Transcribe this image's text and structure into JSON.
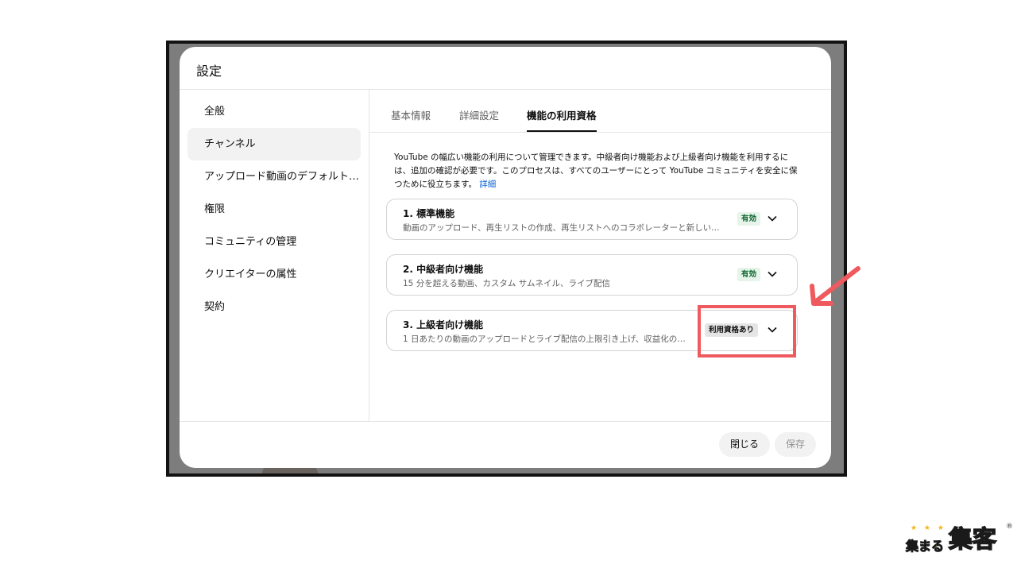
{
  "dialog": {
    "title": "設定"
  },
  "sidebar": {
    "items": [
      {
        "label": "全般"
      },
      {
        "label": "チャンネル"
      },
      {
        "label": "アップロード動画のデフォルト設定"
      },
      {
        "label": "権限"
      },
      {
        "label": "コミュニティの管理"
      },
      {
        "label": "クリエイターの属性"
      },
      {
        "label": "契約"
      }
    ]
  },
  "tabs": [
    {
      "label": "基本情報"
    },
    {
      "label": "詳細設定"
    },
    {
      "label": "機能の利用資格"
    }
  ],
  "description": {
    "text": "YouTube の幅広い機能の利用について管理できます。中級者向け機能および上級者向け機能を利用するには、追加の確認が必要です。このプロセスは、すべてのユーザーにとって YouTube コミュニティを安全に保つために役立ちます。",
    "link": "詳細"
  },
  "features": [
    {
      "title": "1. 標準機能",
      "subtitle": "動画のアップロード、再生リストの作成、再生リストへのコラボレーターと新しい…",
      "status": "有効"
    },
    {
      "title": "2. 中級者向け機能",
      "subtitle": "15 分を超える動画、カスタム サムネイル、ライブ配信",
      "status": "有効"
    },
    {
      "title": "3. 上級者向け機能",
      "subtitle": "1 日あたりの動画のアップロードとライブ配信の上限引き上げ、収益化の…",
      "status": "利用資格あり"
    }
  ],
  "footer": {
    "close_label": "閉じる",
    "save_label": "保存"
  },
  "colors": {
    "highlight": "#ef5a5f",
    "link": "#065fd4",
    "enabled_badge": "#e6f4ea",
    "logo_pink": "#ee4f9a",
    "logo_yellow": "#f3b51c"
  },
  "logo": {
    "stars": "★ ★ ★",
    "text_small": "集まる",
    "text_large": "集客",
    "mark": "®"
  }
}
